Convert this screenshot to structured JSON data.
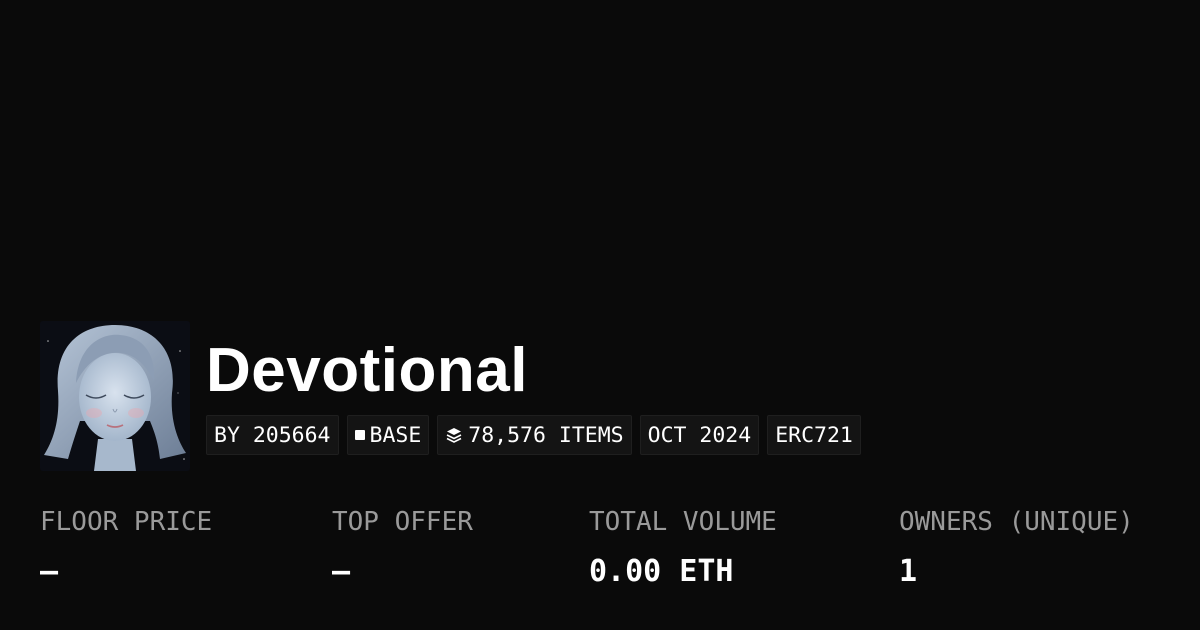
{
  "collection": {
    "name": "Devotional",
    "badges": {
      "creator": "BY 205664",
      "chain": "BASE",
      "items": "78,576 ITEMS",
      "date": "OCT 2024",
      "standard": "ERC721"
    }
  },
  "stats": [
    {
      "label": "FLOOR PRICE",
      "value": "—"
    },
    {
      "label": "TOP OFFER",
      "value": "—"
    },
    {
      "label": "TOTAL VOLUME",
      "value": "0.00 ETH"
    },
    {
      "label": "OWNERS (UNIQUE)",
      "value": "1"
    }
  ],
  "icons": {
    "chain": "square-icon",
    "items": "layers-icon"
  },
  "colors": {
    "background": "#0a0a0a",
    "label": "#9a9a9a",
    "value": "#ffffff",
    "badge_background": "#141414"
  }
}
